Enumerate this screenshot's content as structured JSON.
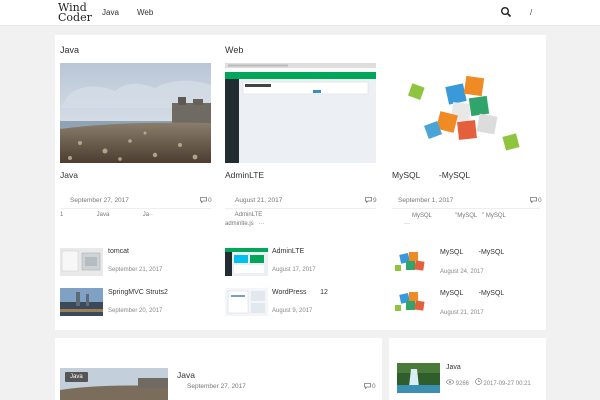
{
  "header": {
    "logo_line1": "Wind",
    "logo_line2": "Coder",
    "nav": [
      "Java",
      "Web"
    ],
    "slash": "/"
  },
  "columns": [
    {
      "heading": "Java",
      "title": "Java",
      "date": "September 27, 2017",
      "comments": "0",
      "excerpt": "1                    Java                    Ja··",
      "items": [
        {
          "title": "tomcat",
          "date": "September 21, 2017"
        },
        {
          "title": "SpringMVC Struts2",
          "date": "September 20, 2017"
        }
      ]
    },
    {
      "heading": "Web",
      "title": "AdminLTE",
      "date": "August 21, 2017",
      "comments": "9",
      "excerpt_line1": "      AdminLTE",
      "excerpt_line2": "adminlte.js   ···",
      "items": [
        {
          "title": "AdminLTE",
          "date": "August 17, 2017"
        },
        {
          "title": "WordPress       12",
          "date": "August 9, 2017"
        }
      ]
    },
    {
      "title": "MySQL        -MySQL",
      "date": "September 1, 2017",
      "comments": "0",
      "excerpt_line1": "MySQL              \"MySQL   \" MySQL",
      "excerpt_line2": "···",
      "items": [
        {
          "title": "MySQL        -MySQL",
          "date": "August 24, 2017"
        },
        {
          "title": "MySQL        -MySQL",
          "date": "August 21, 2017"
        }
      ]
    }
  ],
  "lower": {
    "tag": "Java",
    "title": "Java",
    "date": "September 27, 2017",
    "comments": "0",
    "side_title": "Java",
    "side_views": "9266",
    "side_datetime": "2017-09-27 00:21"
  },
  "colors": {
    "accent": "#2c8a4a",
    "admin_green": "#00a65a"
  },
  "icons": [
    "search-icon",
    "comment-icon",
    "eye-icon",
    "clock-icon"
  ]
}
